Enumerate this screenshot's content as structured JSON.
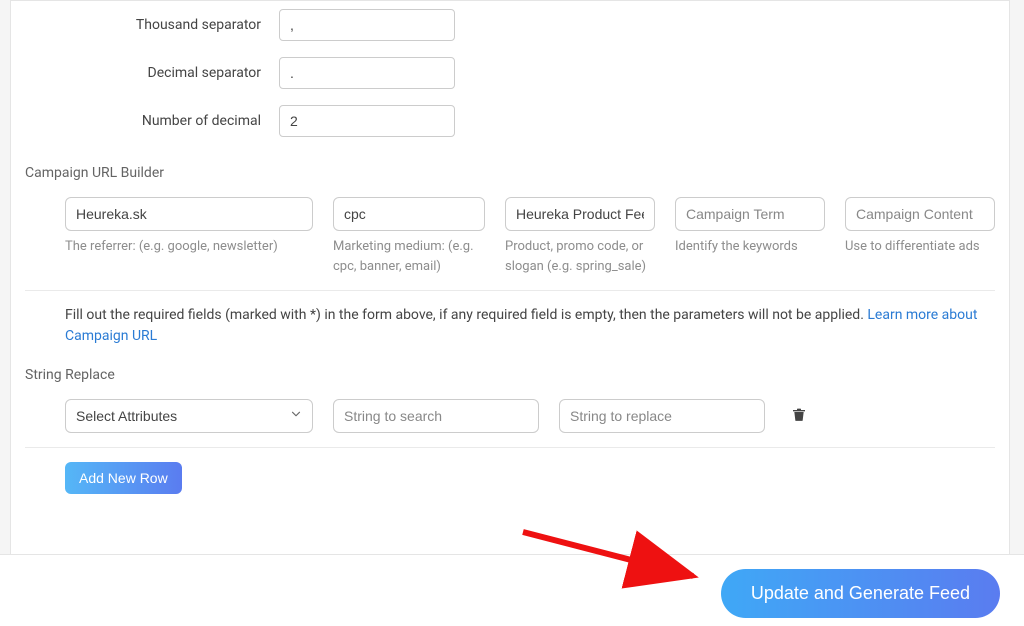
{
  "number_format": {
    "thousand_label": "Thousand separator",
    "thousand_value": ",",
    "decimal_sep_label": "Decimal separator",
    "decimal_sep_value": ".",
    "decimal_count_label": "Number of decimal",
    "decimal_count_value": "2"
  },
  "campaign": {
    "heading": "Campaign URL Builder",
    "source": {
      "value": "Heureka.sk",
      "hint": "The referrer: (e.g. google, newsletter)"
    },
    "medium": {
      "value": "cpc",
      "hint": "Marketing medium: (e.g. cpc, banner, email)"
    },
    "name": {
      "value": "Heureka Product Feed",
      "hint": "Product, promo code, or slogan (e.g. spring_sale)"
    },
    "term": {
      "placeholder": "Campaign Term",
      "hint": "Identify the keywords"
    },
    "content": {
      "placeholder": "Campaign Content",
      "hint": "Use to differentiate ads"
    },
    "info_text": "Fill out the required fields (marked with *) in the form above, if any required field is empty, then the parameters will not be applied. ",
    "info_link": "Learn more about Campaign URL"
  },
  "string_replace": {
    "heading": "String Replace",
    "select_placeholder": "Select Attributes",
    "search_placeholder": "String to search",
    "replace_placeholder": "String to replace",
    "add_row_label": "Add New Row"
  },
  "footer": {
    "generate_label": "Update and Generate Feed"
  }
}
